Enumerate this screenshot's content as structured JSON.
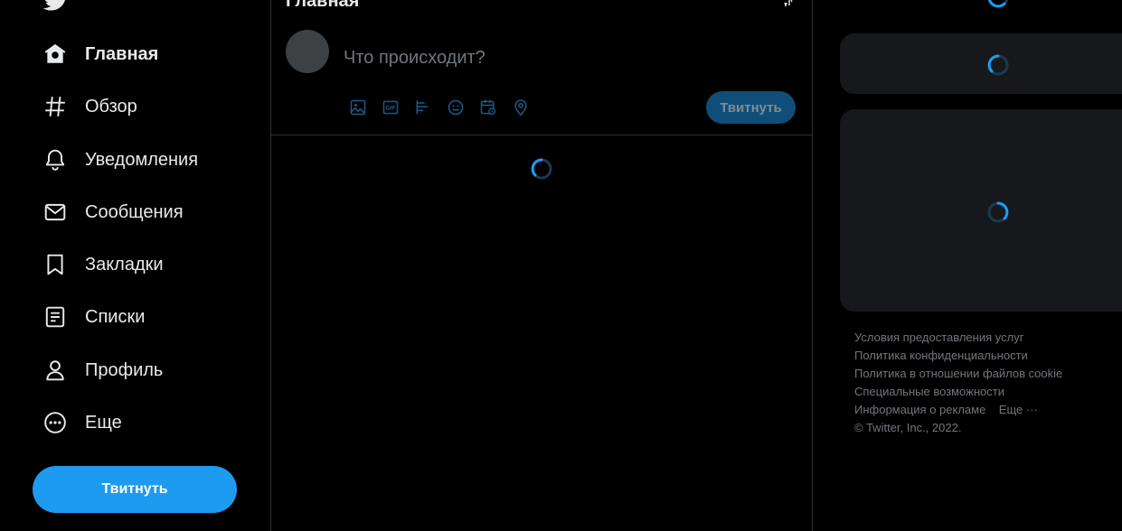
{
  "nav": {
    "items": [
      {
        "label": "Главная",
        "icon": "home-icon",
        "active": true
      },
      {
        "label": "Обзор",
        "icon": "hashtag-icon"
      },
      {
        "label": "Уведомления",
        "icon": "bell-icon"
      },
      {
        "label": "Сообщения",
        "icon": "mail-icon"
      },
      {
        "label": "Закладки",
        "icon": "bookmark-icon"
      },
      {
        "label": "Списки",
        "icon": "list-icon"
      },
      {
        "label": "Профиль",
        "icon": "person-icon"
      },
      {
        "label": "Еще",
        "icon": "more-circle-icon"
      }
    ],
    "tweet_button": "Твитнуть"
  },
  "main": {
    "title": "Главная",
    "compose": {
      "placeholder": "Что происходит?",
      "tweet_button": "Твитнуть",
      "tools": [
        "image-icon",
        "gif-icon",
        "poll-icon",
        "emoji-icon",
        "schedule-icon",
        "location-icon"
      ]
    }
  },
  "footer": {
    "links": [
      "Условия предоставления услуг",
      "Политика конфиденциальности",
      "Политика в отношении файлов cookie",
      "Специальные возможности",
      "Информация о рекламе"
    ],
    "more": "Еще ···",
    "copyright": "© Twitter, Inc., 2022."
  },
  "colors": {
    "accent": "#1d9bf0",
    "background": "#000000",
    "card": "#16181c",
    "border": "#2f3336"
  }
}
